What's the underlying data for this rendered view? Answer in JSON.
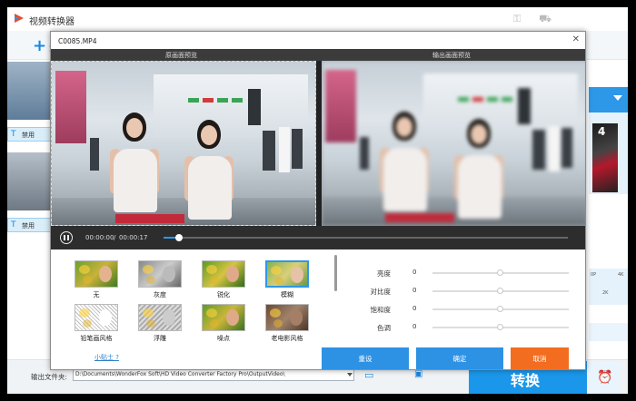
{
  "app": {
    "title": "视频转换器",
    "add_label": "添",
    "subtitle_label": "禁用",
    "output_label": "输出文件夹:",
    "output_path": "D:\\Documents\\WonderFox Soft\\HD Video Converter Factory Pro\\OutputVideo\\",
    "convert_label": "转换",
    "scale_left": "0P",
    "scale_right": "4K",
    "scale_mid": "2K",
    "profile_digit": "4"
  },
  "dialog": {
    "title": "C0085.MP4",
    "close_icon": "close-icon",
    "original_preview_label": "原画面预览",
    "output_preview_label": "输出画面预览",
    "time_current": "00:00:00",
    "time_separator": "/",
    "time_total": "00:00:17",
    "playback_progress": 0.03,
    "effects": [
      {
        "label": "无"
      },
      {
        "label": "灰度"
      },
      {
        "label": "锐化"
      },
      {
        "label": "模糊",
        "selected": true
      },
      {
        "label": "铅笔画风格"
      },
      {
        "label": "浮雕"
      },
      {
        "label": "噪点"
      },
      {
        "label": "老电影风格"
      }
    ],
    "tips_link": "小贴士 ?",
    "adjustments": [
      {
        "label": "亮度",
        "value": "0"
      },
      {
        "label": "对比度",
        "value": "0"
      },
      {
        "label": "饱和度",
        "value": "0"
      },
      {
        "label": "色调",
        "value": "0"
      }
    ],
    "buttons": {
      "reset": "重设",
      "ok": "确定",
      "cancel": "取消"
    }
  },
  "colors": {
    "accent_blue": "#2e92e4",
    "cancel_orange": "#f36d20",
    "convert_blue": "#1a97ea"
  }
}
